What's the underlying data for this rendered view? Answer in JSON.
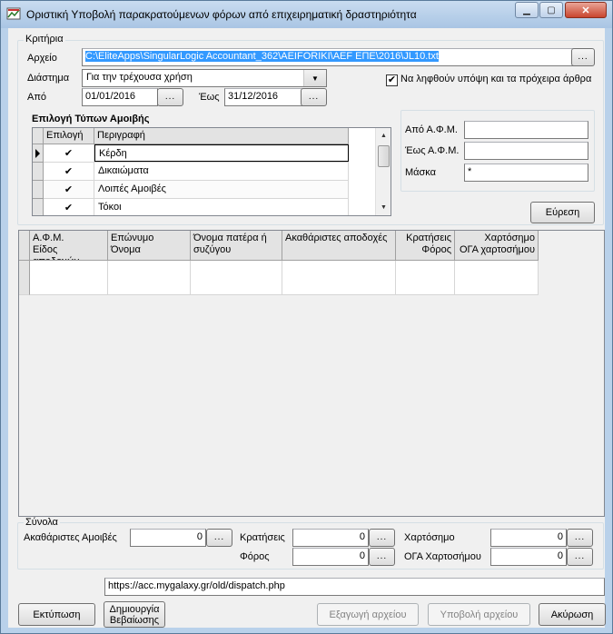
{
  "window": {
    "title": "Οριστική Υποβολή παρακρατούμενων φόρων από επιχειρηματική δραστηριότητα",
    "controls": {
      "minimize": "▁",
      "maximize": "▢",
      "close": "✕"
    }
  },
  "criteria": {
    "group_label": "Κριτήρια",
    "file_label": "Αρχείο",
    "file_value": "C:\\EliteApps\\SingularLogic Accountant_362\\AEIFORIKI\\AEF ΕΠΕ\\2016\\JL10.txt",
    "browse": "...",
    "period_label": "Διάστημα",
    "period_value": "Για την τρέχουσα χρήση",
    "from_label": "Από",
    "from_value": "01/01/2016",
    "to_label": "Έως",
    "to_value": "31/12/2016",
    "drafts_label": "Να ληφθούν υπόψη και τα πρόχειρα άρθρα",
    "drafts_checked": "✔"
  },
  "payment_types": {
    "title": "Επιλογή Τύπων Αμοιβής",
    "headers": [
      "Επιλογή",
      "Περιγραφή"
    ],
    "rows": [
      {
        "check": "✔",
        "label": "Κέρδη"
      },
      {
        "check": "✔",
        "label": "Δικαιώματα"
      },
      {
        "check": "✔",
        "label": "Λοιπές Αμοιβές"
      },
      {
        "check": "✔",
        "label": "Τόκοι"
      }
    ]
  },
  "afm_filter": {
    "from_label": "Από Α.Φ.Μ.",
    "from_value": "",
    "to_label": "Έως Α.Φ.Μ.",
    "to_value": "",
    "mask_label": "Μάσκα",
    "mask_value": "*",
    "search_button": "Εύρεση"
  },
  "results": {
    "headers": [
      [
        "Α.Φ.Μ.",
        "Είδος αποδοχών"
      ],
      [
        "Επώνυμο",
        "Όνομα"
      ],
      [
        "Όνομα πατέρα ή",
        "συζύγου"
      ],
      [
        "Ακαθάριστες αποδοχές",
        ""
      ],
      [
        "Κρατήσεις",
        "Φόρος"
      ],
      [
        "Χαρτόσημο",
        "ΟΓΑ χαρτοσήμου"
      ]
    ]
  },
  "totals": {
    "group_label": "Σύνολα",
    "gross_label": "Ακαθάριστες Αμοιβές",
    "gross_value": "0",
    "deductions_label": "Κρατήσεις",
    "deductions_value": "0",
    "tax_label": "Φόρος",
    "tax_value": "0",
    "stamp_label": "Χαρτόσημο",
    "stamp_value": "0",
    "oga_label": "ΟΓΑ Χαρτοσήμου",
    "oga_value": "0"
  },
  "url": "https://acc.mygalaxy.gr/old/dispatch.php",
  "buttons": {
    "print": "Εκτύπωση",
    "create_line1": "Δημιουργία",
    "create_line2": "Βεβαίωσης",
    "export": "Εξαγωγή αρχείου",
    "submit": "Υποβολή αρχείου",
    "cancel": "Ακύρωση"
  }
}
